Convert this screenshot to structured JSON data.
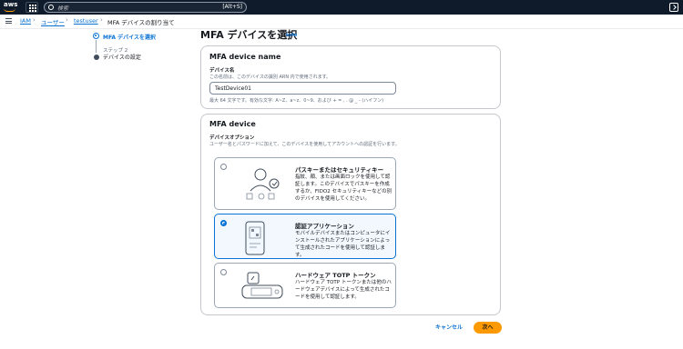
{
  "topnav": {
    "logo_text": "aws",
    "search_placeholder": "検索",
    "search_shortcut": "[Alt+S]"
  },
  "breadcrumb": {
    "items": [
      "IAM",
      "ユーザー",
      "testuser",
      "MFA デバイスの割り当て"
    ]
  },
  "steps": {
    "step1_label": "MFA デバイスを選択",
    "step2_sub": "ステップ 2",
    "step2_label": "デバイスの設定"
  },
  "page": {
    "title": "MFA デバイスを選択",
    "info": "Info"
  },
  "device_name_card": {
    "heading": "MFA device name",
    "label": "デバイス名",
    "description": "この名前は、このデバイスの識別 ARN 内で使用されます。",
    "value": "TestDevice01",
    "hint": "最大 64 文字です。有効な文字: A~Z、a~z、0~9、および + = , . @ _ - (ハイフン)"
  },
  "device_card": {
    "heading": "MFA device",
    "label": "デバイスオプション",
    "description": "ユーザー名とパスワードに加えて、このデバイスを使用してアカウントへの認証を行います。",
    "options": [
      {
        "title": "パスキーまたはセキュリティキー",
        "description": "指紋、顔、または画面ロックを使用して認証します。このデバイスでパスキーを作成するか、FIDO2 セキュリティキーなどの別のデバイスを使用してください。",
        "selected": false,
        "icon": "passkey-illustration"
      },
      {
        "title": "認証アプリケーション",
        "description": "モバイルデバイスまたはコンピュータにインストールされたアプリケーションによって生成されたコードを使用して認証します。",
        "selected": true,
        "icon": "authenticator-app-illustration"
      },
      {
        "title": "ハードウェア TOTP トークン",
        "description": "ハードウェア TOTP トークンまたは他のハードウェアデバイスによって生成されたコードを使用して認証します。",
        "selected": false,
        "icon": "hardware-token-illustration"
      }
    ]
  },
  "footer": {
    "cancel": "キャンセル",
    "next": "次へ"
  },
  "colors": {
    "nav_bg": "#0f1b2a",
    "link": "#0972d3",
    "primary_button": "#ff9900",
    "selected_bg": "#f2f8fd"
  }
}
